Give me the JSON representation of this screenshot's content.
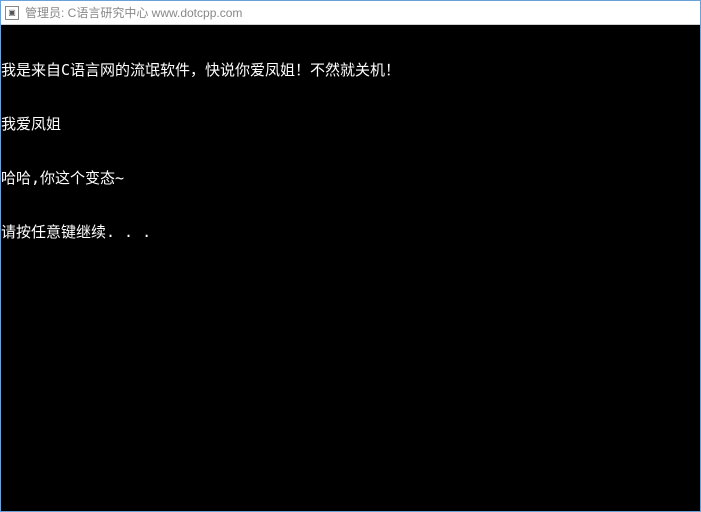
{
  "titlebar": {
    "title": "管理员:  C语言研究中心 www.dotcpp.com"
  },
  "console": {
    "lines": [
      "我是来自C语言网的流氓软件，快说你爱凤姐！不然就关机！",
      "我爱凤姐",
      "哈哈,你这个变态~",
      "请按任意键继续. . ."
    ]
  }
}
